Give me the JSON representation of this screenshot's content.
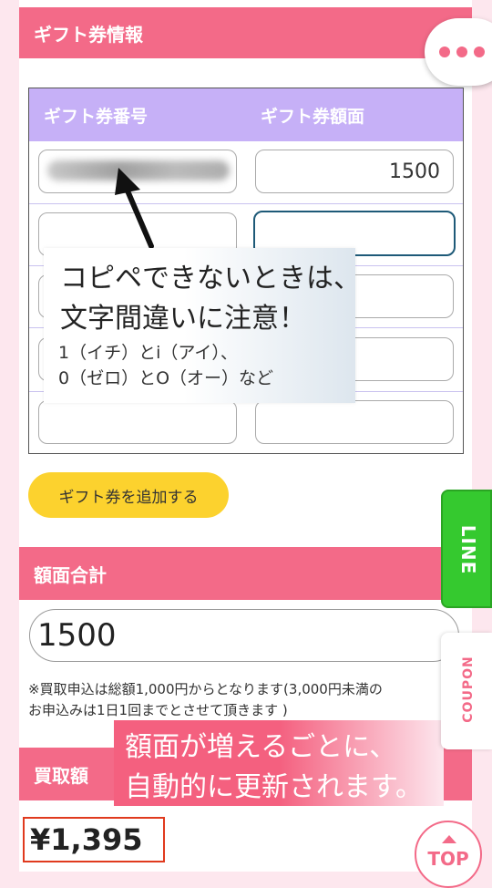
{
  "sections": {
    "gift_info_title": "ギフト券情報",
    "total_title": "額面合計",
    "buy_price_title": "買取額"
  },
  "table": {
    "headers": [
      "ギフト券番号",
      "ギフト券額面"
    ],
    "rows": [
      {
        "code": "",
        "amount": "1500"
      },
      {
        "code": "",
        "amount": ""
      },
      {
        "code": "",
        "amount": ""
      },
      {
        "code": "",
        "amount": ""
      },
      {
        "code": "",
        "amount": ""
      }
    ]
  },
  "callout_copy": {
    "line1": "コピペできないときは、",
    "line2": "文字間違いに注意！",
    "line3": "1（イチ）とi（アイ）、",
    "line4": "0（ゼロ）とO（オー）など"
  },
  "add_button_label": "ギフト券を追加する",
  "total_value": "1500",
  "note": {
    "line1": "※買取申込は総額1,000円からとなります(3,000円未満の",
    "line2": "お申込みは1日1回までとさせて頂きます )"
  },
  "callout_update": {
    "line1": "額面が増えるごとに、",
    "line2": "自動的に更新されます。"
  },
  "buy_price": "¥1,395",
  "side_tabs": {
    "line": "LINE",
    "coupon": "COUPON"
  },
  "top_button": "TOP",
  "icons": [
    "more-icon",
    "arrow-icon",
    "up-triangle-icon"
  ],
  "colors": {
    "accent_pink": "#f36a88",
    "header_purple": "#c6b0f7",
    "button_yellow": "#fcd22e",
    "line_green": "#35c92f"
  }
}
